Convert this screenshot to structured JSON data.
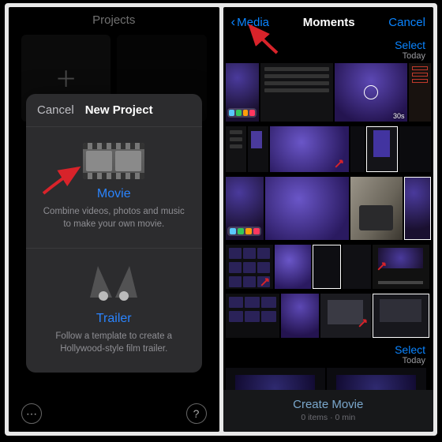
{
  "left": {
    "header": "Projects",
    "sheet": {
      "cancel": "Cancel",
      "title": "New Project",
      "movie": {
        "title": "Movie",
        "desc": "Combine videos, photos and music to make your own movie."
      },
      "trailer": {
        "title": "Trailer",
        "desc": "Follow a template to create a Hollywood-style film trailer."
      }
    }
  },
  "right": {
    "back": "Media",
    "title": "Moments",
    "cancel": "Cancel",
    "section1": {
      "select": "Select",
      "day": "Today",
      "vid_duration": "30s"
    },
    "section2": {
      "select": "Select",
      "day": "Today"
    },
    "create": {
      "title": "Create Movie",
      "sub": "0 items · 0 min"
    }
  }
}
